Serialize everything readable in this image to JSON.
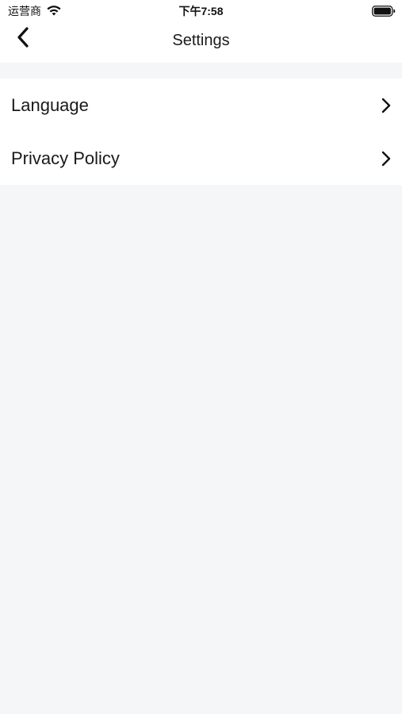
{
  "status_bar": {
    "carrier": "运营商",
    "time": "下午7:58",
    "icons": [
      "wifi-icon",
      "battery-icon"
    ]
  },
  "nav": {
    "title": "Settings",
    "back_icon": "chevron-left-icon"
  },
  "settings": {
    "items": [
      {
        "label": "Language",
        "icon": "chevron-right-icon"
      },
      {
        "label": "Privacy Policy",
        "icon": "chevron-right-icon"
      }
    ]
  },
  "colors": {
    "background": "#f5f6f8",
    "surface": "#ffffff",
    "text": "#1a1a1a"
  }
}
